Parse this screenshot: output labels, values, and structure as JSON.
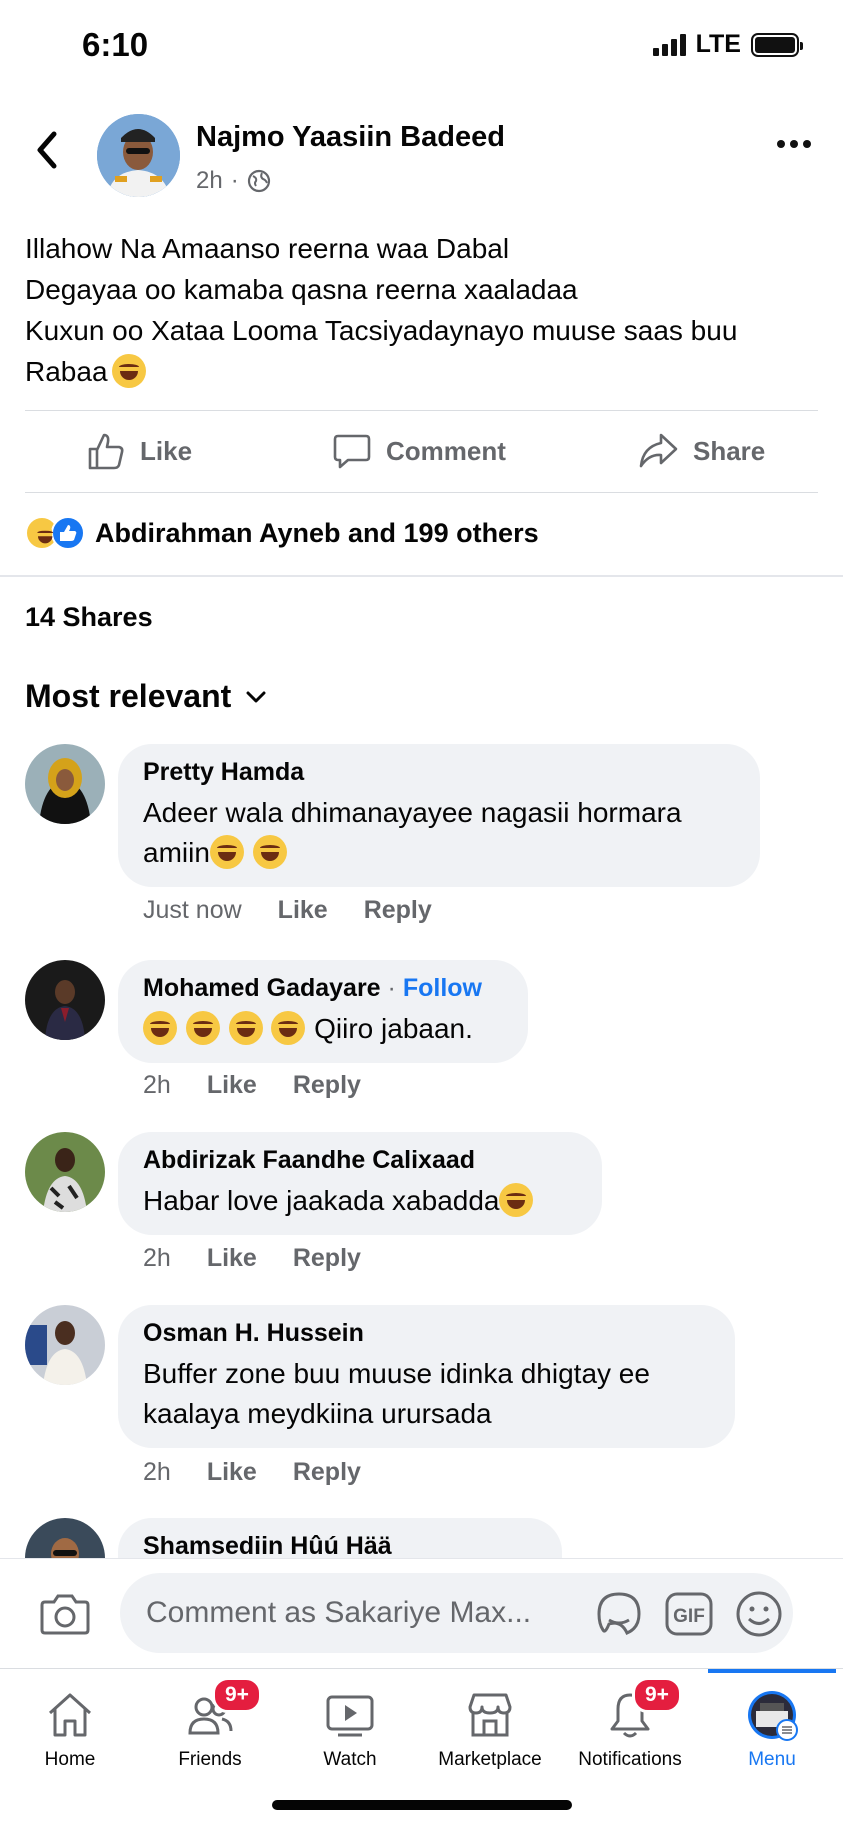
{
  "status": {
    "time": "6:10",
    "network": "LTE"
  },
  "post": {
    "author": "Najmo Yaasiin Badeed",
    "time": "2h",
    "text": "Illahow Na Amaanso reerna waa Dabal\nDegayaa oo kamaba qasna reerna xaaladaa\nKuxun oo Xataa Looma Tacsiyadaynayo muuse saas buu Rabaa",
    "actions": {
      "like": "Like",
      "comment": "Comment",
      "share": "Share"
    },
    "reactions_summary": "Abdirahman Ayneb and 199 others",
    "shares": "14 Shares"
  },
  "sort_label": "Most relevant",
  "comments": [
    {
      "name": "Pretty Hamda",
      "text": "Adeer wala dhimanayayee nagasii hormara amiin",
      "time": "Just now",
      "like": "Like",
      "reply": "Reply"
    },
    {
      "name": "Mohamed Gadayare",
      "follow": "Follow",
      "text": "Qiiro jabaan.",
      "time": "2h",
      "like": "Like",
      "reply": "Reply"
    },
    {
      "name": "Abdirizak Faandhe Calixaad",
      "text": "Habar love jaakada xabadda",
      "time": "2h",
      "like": "Like",
      "reply": "Reply"
    },
    {
      "name": "Osman H. Hussein",
      "text": "Buffer zone buu muuse idinka dhigtay ee kaalaya meydkiina urursada",
      "time": "2h",
      "like": "Like",
      "reply": "Reply"
    },
    {
      "name": "Shamsediin Hûú Hää"
    }
  ],
  "composer": {
    "placeholder": "Comment as Sakariye Max...",
    "gif": "GIF"
  },
  "nav": [
    {
      "label": "Home"
    },
    {
      "label": "Friends",
      "badge": "9+"
    },
    {
      "label": "Watch"
    },
    {
      "label": "Marketplace"
    },
    {
      "label": "Notifications",
      "badge": "9+"
    },
    {
      "label": "Menu"
    }
  ],
  "colors": {
    "accent": "#1877f2",
    "badge": "#e41e3f",
    "bubble": "#f0f2f5",
    "secondary_text": "#65676b"
  }
}
